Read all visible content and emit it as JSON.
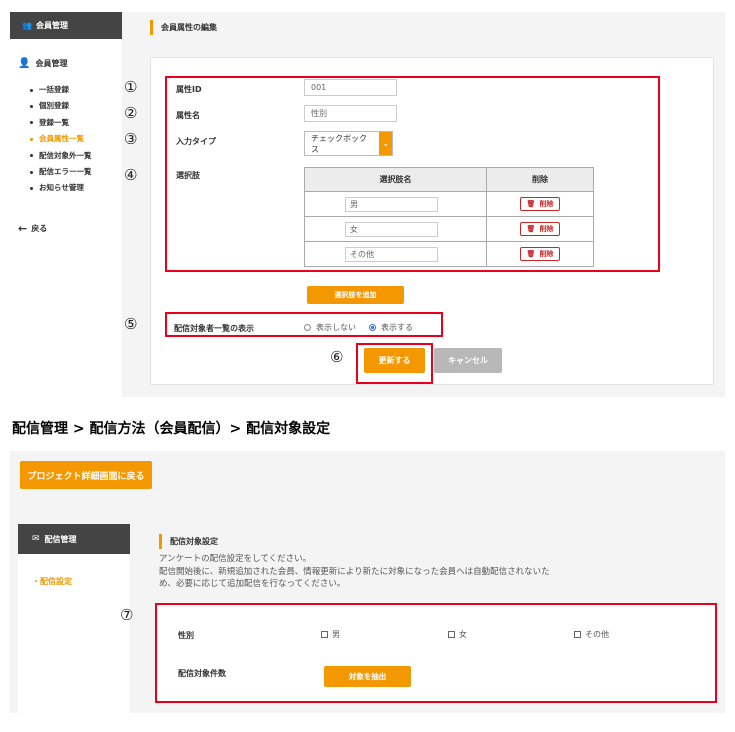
{
  "top": {
    "sidebar": {
      "header": "会員管理",
      "section": "会員管理",
      "items": [
        "一括登録",
        "個別登録",
        "登録一覧",
        "会員属性一覧",
        "配信対象外一覧",
        "配信エラー一覧",
        "お知らせ管理"
      ],
      "back": "戻る"
    },
    "page_title": "会員属性の編集",
    "form": {
      "attr_id_label": "属性ID",
      "attr_id_value": "001",
      "attr_name_label": "属性名",
      "attr_name_value": "性別",
      "input_type_label": "入力タイプ",
      "input_type_value": "チェックボックス",
      "options_label": "選択肢",
      "table_headers": [
        "選択肢名",
        "削除"
      ],
      "options": [
        "男",
        "女",
        "その他"
      ],
      "delete_label": "削除",
      "add_option_label": "選択肢を追加",
      "display_label": "配信対象者一覧の表示",
      "display_options": [
        "表示しない",
        "表示する"
      ],
      "display_selected": "表示する",
      "update_label": "更新する",
      "cancel_label": "キャンセル"
    },
    "markers": [
      "①",
      "②",
      "③",
      "④",
      "⑤",
      "⑥"
    ]
  },
  "caption": "配信管理 > 配信方法（会員配信）> 配信対象設定",
  "bottom": {
    "project_button": "プロジェクト詳細画面に戻る",
    "sidebar": {
      "header": "配信管理",
      "item": "配信設定",
      "item_prefix": "・"
    },
    "title": "配信対象設定",
    "desc_line1": "アンケートの配信設定をしてください。",
    "desc_line2": "配信開始後に、新規追加された会員、情報更新により新たに対象になった会員へは自動配信されないた",
    "desc_line3": "め、必要に応じて追加配信を行なってください。",
    "gender_label": "性別",
    "gender_options": [
      "男",
      "女",
      "その他"
    ],
    "count_label": "配信対象件数",
    "extract_label": "対象を抽出",
    "marker": "⑦"
  },
  "colors": {
    "accent": "#f39800",
    "highlight": "#e8001c",
    "sidebar_head": "#444444",
    "delete": "#c62828"
  }
}
